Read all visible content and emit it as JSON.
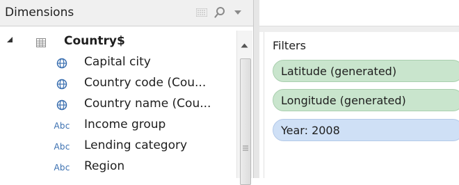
{
  "dimensions_panel": {
    "title": "Dimensions",
    "header_icons": [
      "list-view-icon",
      "search-icon",
      "dropdown-menu-icon"
    ],
    "table": {
      "name": "Country$",
      "expanded": true,
      "icon": "table-icon",
      "fields": [
        {
          "label": "Capital city",
          "type_icon": "globe-icon"
        },
        {
          "label": "Country code (Cou...",
          "type_icon": "globe-icon"
        },
        {
          "label": "Country name (Cou...",
          "type_icon": "globe-icon"
        },
        {
          "label": "Income group",
          "type_icon": "abc",
          "type_text": "Abc"
        },
        {
          "label": "Lending category",
          "type_icon": "abc",
          "type_text": "Abc"
        },
        {
          "label": "Region",
          "type_icon": "abc",
          "type_text": "Abc"
        }
      ]
    }
  },
  "filters_shelf": {
    "title": "Filters",
    "pills": [
      {
        "label": "Latitude (generated)",
        "color": "#c9e5cd"
      },
      {
        "label": "Longitude (generated)",
        "color": "#c9e5cd"
      },
      {
        "label": "Year: 2008",
        "color": "#cfe0f6"
      }
    ]
  },
  "colors": {
    "abc_icon": "#3a6fb0",
    "globe_icon": "#3a6fb0",
    "green_pill": "#c9e5cd",
    "blue_pill": "#cfe0f6"
  }
}
